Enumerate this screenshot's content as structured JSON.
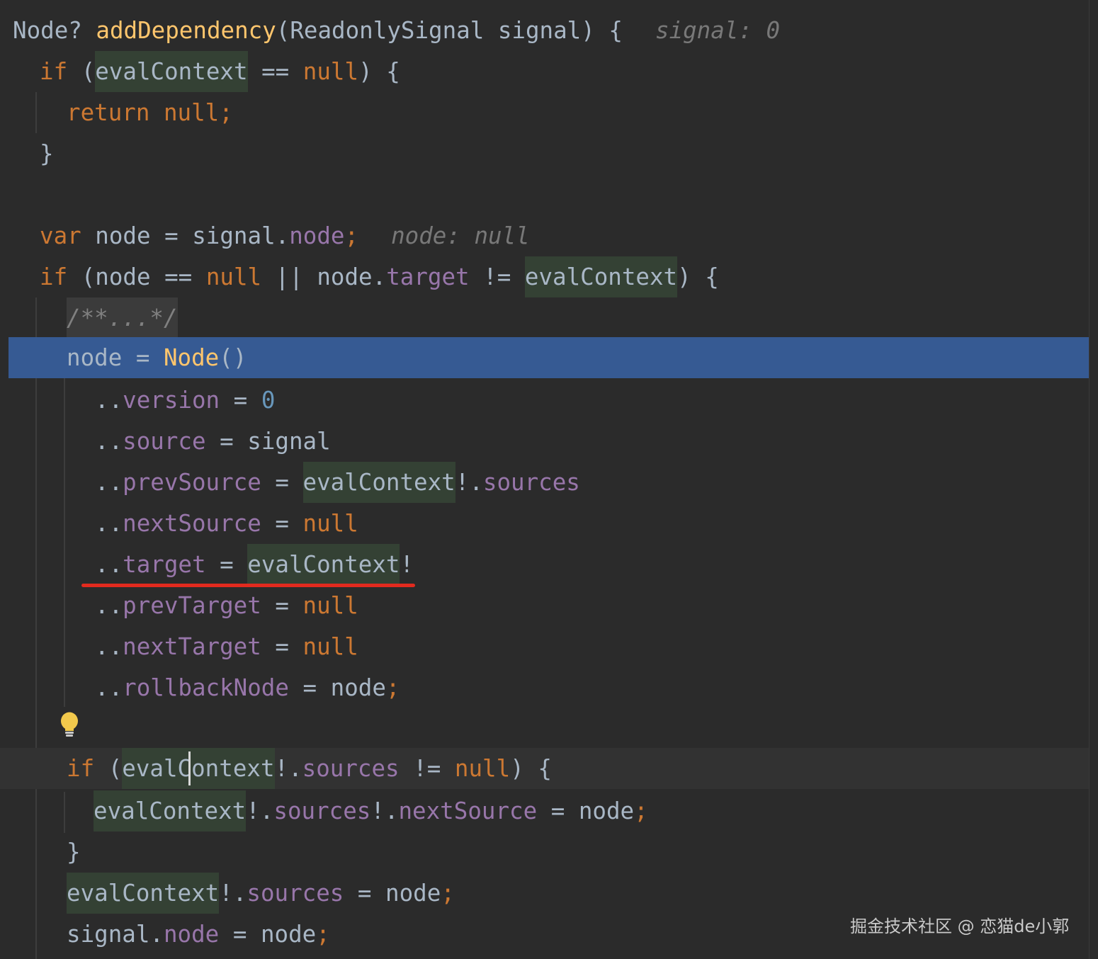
{
  "editor": {
    "theme_colors": {
      "background": "#2b2b2b",
      "keyword": "#cc7832",
      "function": "#ffc66d",
      "number": "#6897bb",
      "property": "#9876aa",
      "plain": "#a9b7c6",
      "hint": "#787878",
      "selection": "#365a93",
      "highlight": "#344134",
      "annotation_underline": "#e22a1e"
    },
    "l1": {
      "a": "Node? ",
      "b": "addDependency",
      "c": "(ReadonlySignal signal) {",
      "hint": "signal: 0"
    },
    "l2": {
      "a": "if",
      "b": " (",
      "c": "evalContext",
      "d": " == ",
      "e": "null",
      "f": ") {"
    },
    "l3": {
      "a": "return null",
      "b": ";"
    },
    "l4": {
      "a": "}"
    },
    "l5": {
      "a": "var",
      "b": " node = signal.",
      "c": "node",
      "d": ";",
      "hint": "node: null"
    },
    "l6": {
      "a": "if",
      "b": " (node == ",
      "c": "null",
      "d": " || node.",
      "e": "target",
      "f": " != ",
      "g": "evalContext",
      "h": ") {"
    },
    "l7": {
      "a": "/**...*/"
    },
    "l8": {
      "a": "node = ",
      "b": "Node",
      "c": "()"
    },
    "l9": {
      "a": "..",
      "b": "version",
      "c": " = ",
      "d": "0"
    },
    "l10": {
      "a": "..",
      "b": "source",
      "c": " = signal"
    },
    "l11": {
      "a": "..",
      "b": "prevSource",
      "c": " = ",
      "d": "evalContext",
      "e": "!.",
      "f": "sources"
    },
    "l12": {
      "a": "..",
      "b": "nextSource",
      "c": " = ",
      "d": "null"
    },
    "l13": {
      "a": "..",
      "b": "target",
      "c": " = ",
      "d": "evalContext",
      "e": "!"
    },
    "l14": {
      "a": "..",
      "b": "prevTarget",
      "c": " = ",
      "d": "null"
    },
    "l15": {
      "a": "..",
      "b": "nextTarget",
      "c": " = ",
      "d": "null"
    },
    "l16": {
      "a": "..",
      "b": "rollbackNode",
      "c": " = node",
      "d": ";"
    },
    "l17": {
      "a": "if",
      "b": " (",
      "c": "evalContext",
      "d": "!.",
      "e": "sources",
      "f": " != ",
      "g": "null",
      "h": ") {"
    },
    "l18": {
      "a": "evalContext",
      "b": "!.",
      "c": "sources",
      "d": "!.",
      "e": "nextSource",
      "f": " = node",
      "g": ";"
    },
    "l19": {
      "a": "}"
    },
    "l20": {
      "a": "evalContext",
      "b": "!.",
      "c": "sources",
      "d": " = node",
      "e": ";"
    },
    "l21": {
      "a": "signal.",
      "b": "node",
      "c": " = node",
      "d": ";"
    }
  },
  "watermark": "掘金技术社区 @ 恋猫de小郭",
  "icons": {
    "intention": "lightbulb-icon"
  }
}
